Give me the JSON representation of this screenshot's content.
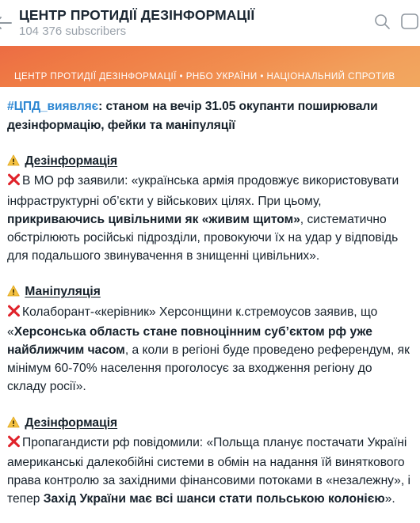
{
  "header": {
    "back_icon": "back-arrow-icon",
    "title": "ЦЕНТР ПРОТИДІЇ ДЕЗІНФОРМАЦІЇ",
    "subscribers": "104 376 subscribers",
    "search_icon": "search-icon",
    "menu_icon": "more-options-icon",
    "title_color": "#1b2733",
    "subs_color": "#9aa2ab"
  },
  "banner": {
    "caption": "ЦЕНТР ПРОТИДІЇ ДЕЗІНФОРМАЦІЇ • РНБО УКРАЇНИ • НАЦІОНАЛЬНИЙ СПРОТИВ",
    "gradient_from": "#ec6c43",
    "gradient_to": "#f2a85f"
  },
  "message": {
    "link_color": "#2e87d2",
    "hashtag": "#ЦПД_виявляє",
    "intro_rest": ": станом на вечір 31.05 окупанти поширювали дезінформацію, фейки та маніпуляції",
    "blocks": [
      {
        "warn_emoji": "⚠️",
        "label": "Дезінформація",
        "x_emoji": "❌",
        "lead": "В МО рф заявили: «українська армія продовжує використовувати інфраструктурні об’єкти у військових цілях. При цьому, ",
        "bold": "прикриваючись цивільними як «живим щитом»",
        "tail": ", систематично обстрілюють російські підрозділи, провокуючи їх на удар у відповідь для подальшого звинувачення в знищенні цивільних»."
      },
      {
        "warn_emoji": "⚠️",
        "label": "Маніпуляція",
        "x_emoji": "❌",
        "lead": "Колаборант-«керівник» Херсонщини к.стремоусов заявив, що «",
        "bold": "Херсонська область стане повноцінним суб’єктом рф уже найближчим часом",
        "tail": ", а коли в регіоні буде проведено референдум, як мінімум 60-70% населення проголосує за входження регіону до складу росії»."
      },
      {
        "warn_emoji": "⚠️",
        "label": "Дезінформація",
        "x_emoji": "❌",
        "lead": "Пропагандисти рф повідомили: «Польща планує постачати Україні американські далекобійні системи в обмін на надання їй виняткового права контролю за західними фінансовими потоками в «незалежну», і тепер ",
        "bold": "Захід України має всі шанси стати польською колонією",
        "tail": "»."
      }
    ]
  }
}
